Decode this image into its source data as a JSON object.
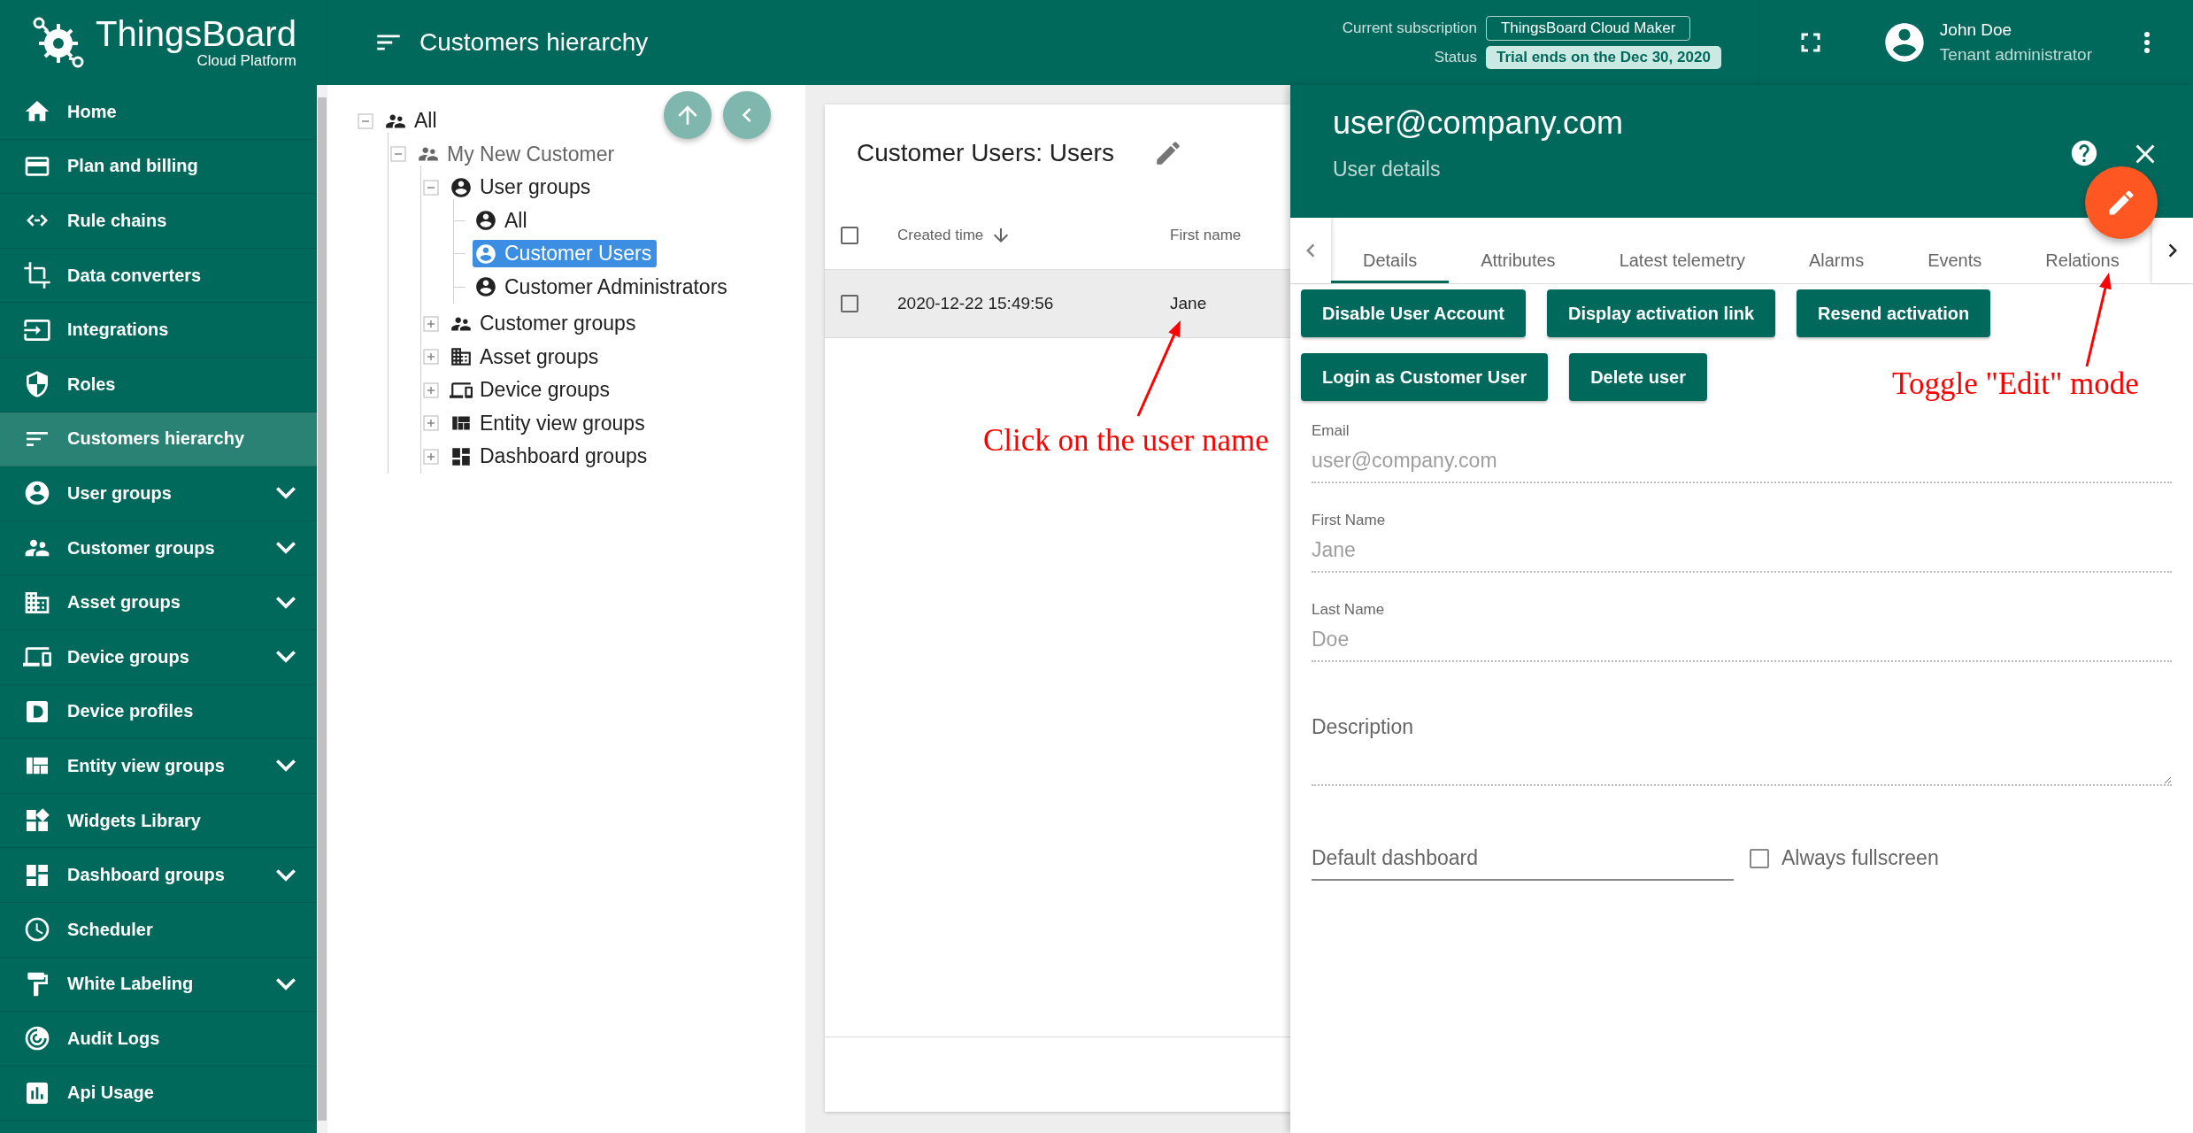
{
  "topbar": {
    "logo": {
      "name": "ThingsBoard",
      "subtitle": "Cloud Platform"
    },
    "title": "Customers hierarchy",
    "subscription": {
      "label": "Current subscription",
      "plan": "ThingsBoard Cloud Maker",
      "status_label": "Status",
      "status": "Trial ends on the Dec 30, 2020"
    },
    "user": {
      "name": "John Doe",
      "role": "Tenant administrator"
    }
  },
  "sidebar": {
    "items": [
      {
        "label": "Home",
        "selected": false,
        "expandable": false
      },
      {
        "label": "Plan and billing",
        "selected": false,
        "expandable": false
      },
      {
        "label": "Rule chains",
        "selected": false,
        "expandable": false
      },
      {
        "label": "Data converters",
        "selected": false,
        "expandable": false
      },
      {
        "label": "Integrations",
        "selected": false,
        "expandable": false
      },
      {
        "label": "Roles",
        "selected": false,
        "expandable": false
      },
      {
        "label": "Customers hierarchy",
        "selected": true,
        "expandable": false
      },
      {
        "label": "User groups",
        "selected": false,
        "expandable": true
      },
      {
        "label": "Customer groups",
        "selected": false,
        "expandable": true
      },
      {
        "label": "Asset groups",
        "selected": false,
        "expandable": true
      },
      {
        "label": "Device groups",
        "selected": false,
        "expandable": true
      },
      {
        "label": "Device profiles",
        "selected": false,
        "expandable": false
      },
      {
        "label": "Entity view groups",
        "selected": false,
        "expandable": true
      },
      {
        "label": "Widgets Library",
        "selected": false,
        "expandable": false
      },
      {
        "label": "Dashboard groups",
        "selected": false,
        "expandable": true
      },
      {
        "label": "Scheduler",
        "selected": false,
        "expandable": false
      },
      {
        "label": "White Labeling",
        "selected": false,
        "expandable": true
      },
      {
        "label": "Audit Logs",
        "selected": false,
        "expandable": false
      },
      {
        "label": "Api Usage",
        "selected": false,
        "expandable": false
      }
    ]
  },
  "tree": {
    "nodes": [
      {
        "label": "All",
        "kind": "customers",
        "selected": false,
        "expanded": true,
        "children": [
          {
            "label": "My New Customer",
            "kind": "customer",
            "selected": false,
            "expanded": true,
            "children": [
              {
                "label": "User groups",
                "kind": "user",
                "selected": false,
                "expanded": true,
                "children": [
                  {
                    "label": "All",
                    "kind": "user",
                    "selected": false
                  },
                  {
                    "label": "Customer Users",
                    "kind": "user",
                    "selected": true
                  },
                  {
                    "label": "Customer Administrators",
                    "kind": "user",
                    "selected": false
                  }
                ]
              },
              {
                "label": "Customer groups",
                "kind": "customers",
                "selected": false,
                "expanded": false
              },
              {
                "label": "Asset groups",
                "kind": "asset",
                "selected": false,
                "expanded": false
              },
              {
                "label": "Device groups",
                "kind": "device",
                "selected": false,
                "expanded": false
              },
              {
                "label": "Entity view groups",
                "kind": "entity-view",
                "selected": false,
                "expanded": false
              },
              {
                "label": "Dashboard groups",
                "kind": "dashboard",
                "selected": false,
                "expanded": false
              }
            ]
          }
        ]
      }
    ]
  },
  "users_table": {
    "title": "Customer Users: Users",
    "header_checked": false,
    "columns": [
      {
        "label": "Created time",
        "sorted": true
      },
      {
        "label": "First name",
        "sorted": false
      }
    ],
    "rows": [
      {
        "cells": [
          "2020-12-22 15:49:56",
          "Jane"
        ],
        "checked": false,
        "highlighted": true
      }
    ]
  },
  "details": {
    "title": "user@company.com",
    "subtitle": "User details",
    "tabs": [
      {
        "label": "Details",
        "selected": true
      },
      {
        "label": "Attributes",
        "selected": false
      },
      {
        "label": "Latest telemetry",
        "selected": false
      },
      {
        "label": "Alarms",
        "selected": false
      },
      {
        "label": "Events",
        "selected": false
      },
      {
        "label": "Relations",
        "selected": false
      }
    ],
    "action_rows": [
      [
        "Disable User Account",
        "Display activation link",
        "Resend activation"
      ],
      [
        "Login as Customer User",
        "Delete user"
      ]
    ],
    "fields": [
      {
        "label": "Email",
        "value": "user@company.com",
        "disabled": true
      },
      {
        "label": "First Name",
        "value": "Jane",
        "disabled": true
      },
      {
        "label": "Last Name",
        "value": "Doe",
        "disabled": true
      }
    ],
    "description": {
      "placeholder": "Description"
    },
    "default_dashboard": {
      "placeholder": "Default dashboard"
    },
    "always_fullscreen": {
      "label": "Always fullscreen",
      "checked": false
    }
  },
  "annotations": [
    {
      "text": "Click on the user name"
    },
    {
      "text": "Toggle \"Edit\" mode"
    }
  ]
}
